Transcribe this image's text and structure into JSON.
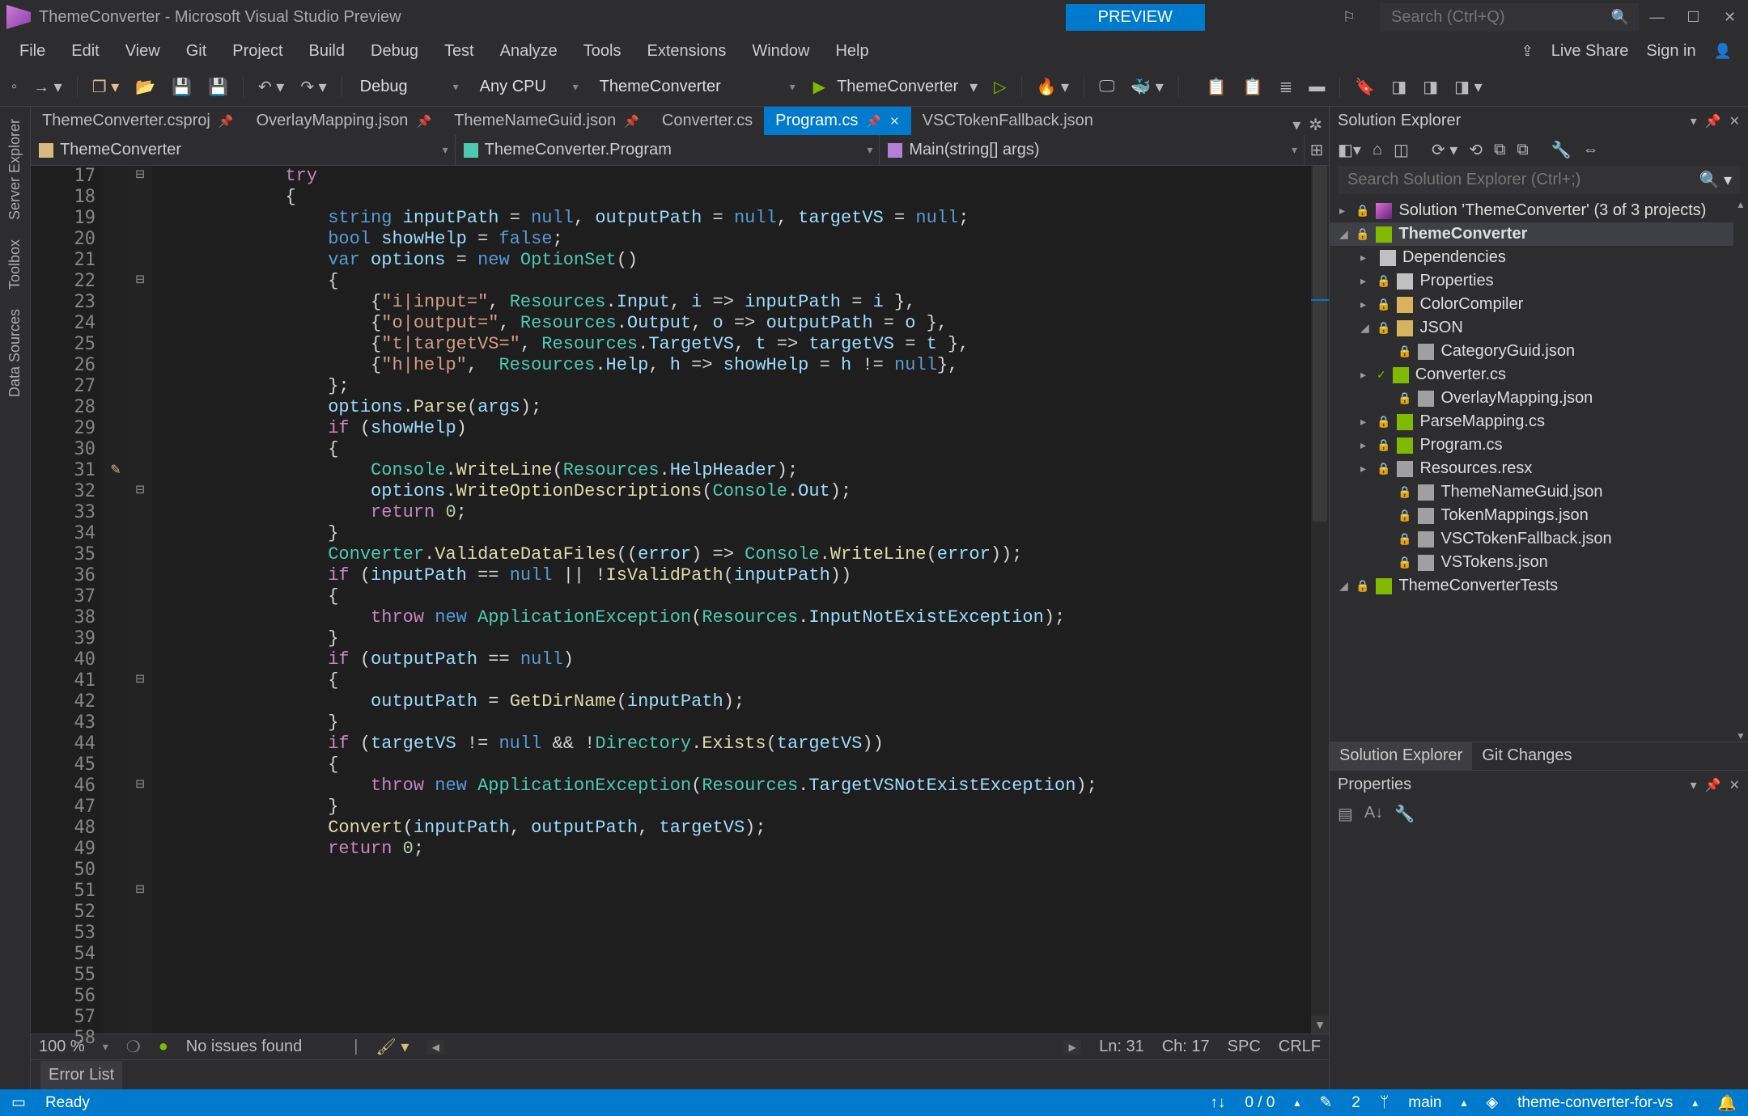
{
  "titlebar": {
    "title": "ThemeConverter - Microsoft Visual Studio Preview",
    "preview": "PREVIEW",
    "search_ph": "Search (Ctrl+Q)",
    "min": "—",
    "max": "☐",
    "close": "✕"
  },
  "menu": {
    "items": [
      "File",
      "Edit",
      "View",
      "Git",
      "Project",
      "Build",
      "Debug",
      "Test",
      "Analyze",
      "Tools",
      "Extensions",
      "Window",
      "Help"
    ],
    "liveshare": "Live Share",
    "signin": "Sign in"
  },
  "toolbar": {
    "config": "Debug",
    "platform": "Any CPU",
    "startup": "ThemeConverter",
    "run": "ThemeConverter"
  },
  "siderail": [
    "Server Explorer",
    "Toolbox",
    "Data Sources"
  ],
  "docTabs": [
    {
      "label": "ThemeConverter.csproj",
      "pinned": true
    },
    {
      "label": "OverlayMapping.json",
      "pinned": true
    },
    {
      "label": "ThemeNameGuid.json",
      "pinned": true
    },
    {
      "label": "Converter.cs",
      "pinned": false
    },
    {
      "label": "Program.cs",
      "pinned": true,
      "active": true,
      "close": true
    },
    {
      "label": "VSCTokenFallback.json",
      "pinned": false
    }
  ],
  "navbar": {
    "project": "ThemeConverter",
    "class": "ThemeConverter.Program",
    "method": "Main(string[] args)"
  },
  "code": {
    "startLine": 17,
    "cursorLine": 31,
    "lines": [
      {
        "html": "            <span class='ctrl'>try</span>"
      },
      {
        "html": "            <span class='p'>{</span>"
      },
      {
        "html": "                <span class='kw'>string</span> <span class='id'>inputPath</span> <span class='op'>=</span> <span class='kw'>null</span><span class='p'>,</span> <span class='id'>outputPath</span> <span class='op'>=</span> <span class='kw'>null</span><span class='p'>,</span> <span class='id'>targetVS</span> <span class='op'>=</span> <span class='kw'>null</span><span class='p'>;</span>"
      },
      {
        "html": "                <span class='kw'>bool</span> <span class='id'>showHelp</span> <span class='op'>=</span> <span class='kw'>false</span><span class='p'>;</span>"
      },
      {
        "html": ""
      },
      {
        "html": "                <span class='kw'>var</span> <span class='id'>options</span> <span class='op'>=</span> <span class='kw'>new</span> <span class='cls'>OptionSet</span><span class='p'>()</span>"
      },
      {
        "html": "                <span class='p'>{</span>"
      },
      {
        "html": "                    <span class='p'>{</span><span class='str'>\"i|input=\"</span><span class='p'>,</span> <span class='cls'>Resources</span><span class='p'>.</span><span class='id'>Input</span><span class='p'>,</span> <span class='id'>i</span> <span class='op'>=&gt;</span> <span class='id'>inputPath</span> <span class='op'>=</span> <span class='id'>i</span> <span class='p'>},</span>"
      },
      {
        "html": "                    <span class='p'>{</span><span class='str'>\"o|output=\"</span><span class='p'>,</span> <span class='cls'>Resources</span><span class='p'>.</span><span class='id'>Output</span><span class='p'>,</span> <span class='id'>o</span> <span class='op'>=&gt;</span> <span class='id'>outputPath</span> <span class='op'>=</span> <span class='id'>o</span> <span class='p'>},</span>"
      },
      {
        "html": "                    <span class='p'>{</span><span class='str'>\"t|targetVS=\"</span><span class='p'>,</span> <span class='cls'>Resources</span><span class='p'>.</span><span class='id'>TargetVS</span><span class='p'>,</span> <span class='id'>t</span> <span class='op'>=&gt;</span> <span class='id'>targetVS</span> <span class='op'>=</span> <span class='id'>t</span> <span class='p'>},</span>"
      },
      {
        "html": "                    <span class='p'>{</span><span class='str'>\"h|help\"</span><span class='p'>,</span>  <span class='cls'>Resources</span><span class='p'>.</span><span class='id'>Help</span><span class='p'>,</span> <span class='id'>h</span> <span class='op'>=&gt;</span> <span class='id'>showHelp</span> <span class='op'>=</span> <span class='id'>h</span> <span class='op'>!=</span> <span class='kw'>null</span><span class='p'>},</span>"
      },
      {
        "html": "                <span class='p'>};</span>"
      },
      {
        "html": ""
      },
      {
        "html": "                <span class='id'>options</span><span class='p'>.</span><span class='mth'>Parse</span><span class='p'>(</span><span class='id'>args</span><span class='p'>);</span>"
      },
      {
        "html": ""
      },
      {
        "html": "                <span class='ctrl'>if</span> <span class='p'>(</span><span class='id'>showHelp</span><span class='p'>)</span>"
      },
      {
        "html": "                <span class='p'>{</span>"
      },
      {
        "html": "                    <span class='cls'>Console</span><span class='p'>.</span><span class='mth'>WriteLine</span><span class='p'>(</span><span class='cls'>Resources</span><span class='p'>.</span><span class='id'>HelpHeader</span><span class='p'>);</span>"
      },
      {
        "html": "                    <span class='id'>options</span><span class='p'>.</span><span class='mth'>WriteOptionDescriptions</span><span class='p'>(</span><span class='cls'>Console</span><span class='p'>.</span><span class='id'>Out</span><span class='p'>);</span>"
      },
      {
        "html": "                    <span class='ctrl'>return</span> <span class='num'>0</span><span class='p'>;</span>"
      },
      {
        "html": "                <span class='p'>}</span>"
      },
      {
        "html": ""
      },
      {
        "html": "                <span class='cls'>Converter</span><span class='p'>.</span><span class='mth'>ValidateDataFiles</span><span class='p'>((</span><span class='id'>error</span><span class='p'>)</span> <span class='op'>=&gt;</span> <span class='cls'>Console</span><span class='p'>.</span><span class='mth'>WriteLine</span><span class='p'>(</span><span class='id'>error</span><span class='p'>));</span>"
      },
      {
        "html": ""
      },
      {
        "html": "                <span class='ctrl'>if</span> <span class='p'>(</span><span class='id'>inputPath</span> <span class='op'>==</span> <span class='kw'>null</span> <span class='op'>||</span> <span class='op'>!</span><span class='mth'>IsValidPath</span><span class='p'>(</span><span class='id'>inputPath</span><span class='p'>))</span>"
      },
      {
        "html": "                <span class='p'>{</span>"
      },
      {
        "html": "                    <span class='ctrl'>throw</span> <span class='kw'>new</span> <span class='cls'>ApplicationException</span><span class='p'>(</span><span class='cls'>Resources</span><span class='p'>.</span><span class='id'>InputNotExistException</span><span class='p'>);</span>"
      },
      {
        "html": "                <span class='p'>}</span>"
      },
      {
        "html": ""
      },
      {
        "html": "                <span class='ctrl'>if</span> <span class='p'>(</span><span class='id'>outputPath</span> <span class='op'>==</span> <span class='kw'>null</span><span class='p'>)</span>"
      },
      {
        "html": "                <span class='p'>{</span>"
      },
      {
        "html": "                    <span class='id'>outputPath</span> <span class='op'>=</span> <span class='mth'>GetDirName</span><span class='p'>(</span><span class='id'>inputPath</span><span class='p'>);</span>"
      },
      {
        "html": "                <span class='p'>}</span>"
      },
      {
        "html": ""
      },
      {
        "html": "                <span class='ctrl'>if</span> <span class='p'>(</span><span class='id'>targetVS</span> <span class='op'>!=</span> <span class='kw'>null</span> <span class='op'>&amp;&amp;</span> <span class='op'>!</span><span class='cls'>Directory</span><span class='p'>.</span><span class='mth'>Exists</span><span class='p'>(</span><span class='id'>targetVS</span><span class='p'>))</span>"
      },
      {
        "html": "                <span class='p'>{</span>"
      },
      {
        "html": "                    <span class='ctrl'>throw</span> <span class='kw'>new</span> <span class='cls'>ApplicationException</span><span class='p'>(</span><span class='cls'>Resources</span><span class='p'>.</span><span class='id'>TargetVSNotExistException</span><span class='p'>);</span>"
      },
      {
        "html": "                <span class='p'>}</span>"
      },
      {
        "html": ""
      },
      {
        "html": "                <span class='mth'>Convert</span><span class='p'>(</span><span class='id'>inputPath</span><span class='p'>,</span> <span class='id'>outputPath</span><span class='p'>,</span> <span class='id'>targetVS</span><span class='p'>);</span>"
      },
      {
        "html": ""
      },
      {
        "html": "                <span class='ctrl'>return</span> <span class='num'>0</span><span class='p'>;</span>"
      }
    ]
  },
  "editorStatus": {
    "zoom": "100 %",
    "issues": "No issues found",
    "ln": "Ln: 31",
    "ch": "Ch: 17",
    "spc": "SPC",
    "crlf": "CRLF"
  },
  "errorList": "Error List",
  "solExplorer": {
    "title": "Solution Explorer",
    "search_ph": "Search Solution Explorer (Ctrl+;)",
    "tree": [
      {
        "depth": 0,
        "arrow": "▸",
        "icon": "sol",
        "lock": true,
        "label": "Solution 'ThemeConverter' (3 of 3 projects)"
      },
      {
        "depth": 0,
        "arrow": "◢",
        "icon": "proj",
        "lock": true,
        "label": "ThemeConverter",
        "selected": true,
        "bold": true
      },
      {
        "depth": 1,
        "arrow": "▸",
        "icon": "ref",
        "label": "Dependencies"
      },
      {
        "depth": 1,
        "arrow": "▸",
        "icon": "ref",
        "lock": true,
        "label": "Properties"
      },
      {
        "depth": 1,
        "arrow": "▸",
        "icon": "folder",
        "lock": true,
        "label": "ColorCompiler"
      },
      {
        "depth": 1,
        "arrow": "◢",
        "icon": "folder",
        "lock": true,
        "label": "JSON"
      },
      {
        "depth": 2,
        "arrow": "",
        "icon": "json",
        "lock": true,
        "label": "CategoryGuid.json"
      },
      {
        "depth": 1,
        "arrow": "▸",
        "icon": "cs",
        "lock": false,
        "check": true,
        "label": "Converter.cs"
      },
      {
        "depth": 2,
        "arrow": "",
        "icon": "json",
        "lock": true,
        "label": "OverlayMapping.json"
      },
      {
        "depth": 1,
        "arrow": "▸",
        "icon": "cs",
        "lock": true,
        "label": "ParseMapping.cs"
      },
      {
        "depth": 1,
        "arrow": "▸",
        "icon": "cs",
        "lock": true,
        "label": "Program.cs"
      },
      {
        "depth": 1,
        "arrow": "▸",
        "icon": "json",
        "lock": true,
        "label": "Resources.resx"
      },
      {
        "depth": 2,
        "arrow": "",
        "icon": "json",
        "lock": true,
        "label": "ThemeNameGuid.json"
      },
      {
        "depth": 2,
        "arrow": "",
        "icon": "json",
        "lock": true,
        "label": "TokenMappings.json"
      },
      {
        "depth": 2,
        "arrow": "",
        "icon": "json",
        "lock": true,
        "label": "VSCTokenFallback.json"
      },
      {
        "depth": 2,
        "arrow": "",
        "icon": "json",
        "lock": true,
        "label": "VSTokens.json"
      },
      {
        "depth": 0,
        "arrow": "◢",
        "icon": "proj",
        "lock": true,
        "label": "ThemeConverterTests"
      }
    ],
    "bottomTabs": [
      "Solution Explorer",
      "Git Changes"
    ]
  },
  "properties": {
    "title": "Properties"
  },
  "statusbar": {
    "ready": "Ready",
    "changes": "0 / 0",
    "conflicts": "2",
    "branch": "main",
    "repo": "theme-converter-for-vs"
  }
}
